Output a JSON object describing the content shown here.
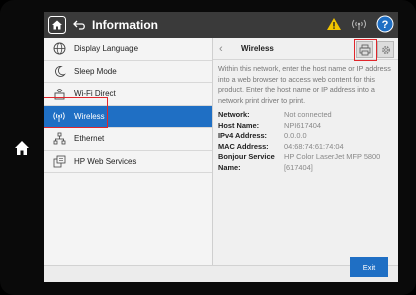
{
  "header": {
    "title": "Information"
  },
  "sidebar": {
    "items": [
      {
        "label": "Display Language",
        "icon": "globe-icon"
      },
      {
        "label": "Sleep Mode",
        "icon": "moon-icon"
      },
      {
        "label": "Wi-Fi Direct",
        "icon": "wifi-direct-icon"
      },
      {
        "label": "Wireless",
        "icon": "wireless-icon",
        "selected": true
      },
      {
        "label": "Ethernet",
        "icon": "ethernet-icon"
      },
      {
        "label": "HP Web Services",
        "icon": "web-services-icon"
      }
    ]
  },
  "panel": {
    "title": "Wireless",
    "description": "Within this network, enter the host name or IP address into a web browser to access web content for this product. Enter the host name or IP address into a network print driver to print.",
    "details": [
      {
        "key": "Network:",
        "value": "Not connected"
      },
      {
        "key": "Host Name:",
        "value": "NPI617404"
      },
      {
        "key": "IPv4 Address:",
        "value": "0.0.0.0"
      },
      {
        "key": "MAC Address:",
        "value": "04:68:74:61:74:04"
      },
      {
        "key": "Bonjour Service Name:",
        "value": "HP Color LaserJet MFP 5800 [617404]"
      }
    ]
  },
  "footer": {
    "exit_label": "Exit"
  },
  "colors": {
    "accent": "#1f6fc4",
    "titlebar": "#3a3a3a",
    "highlight": "#e0262b",
    "warning": "#f2c500"
  }
}
